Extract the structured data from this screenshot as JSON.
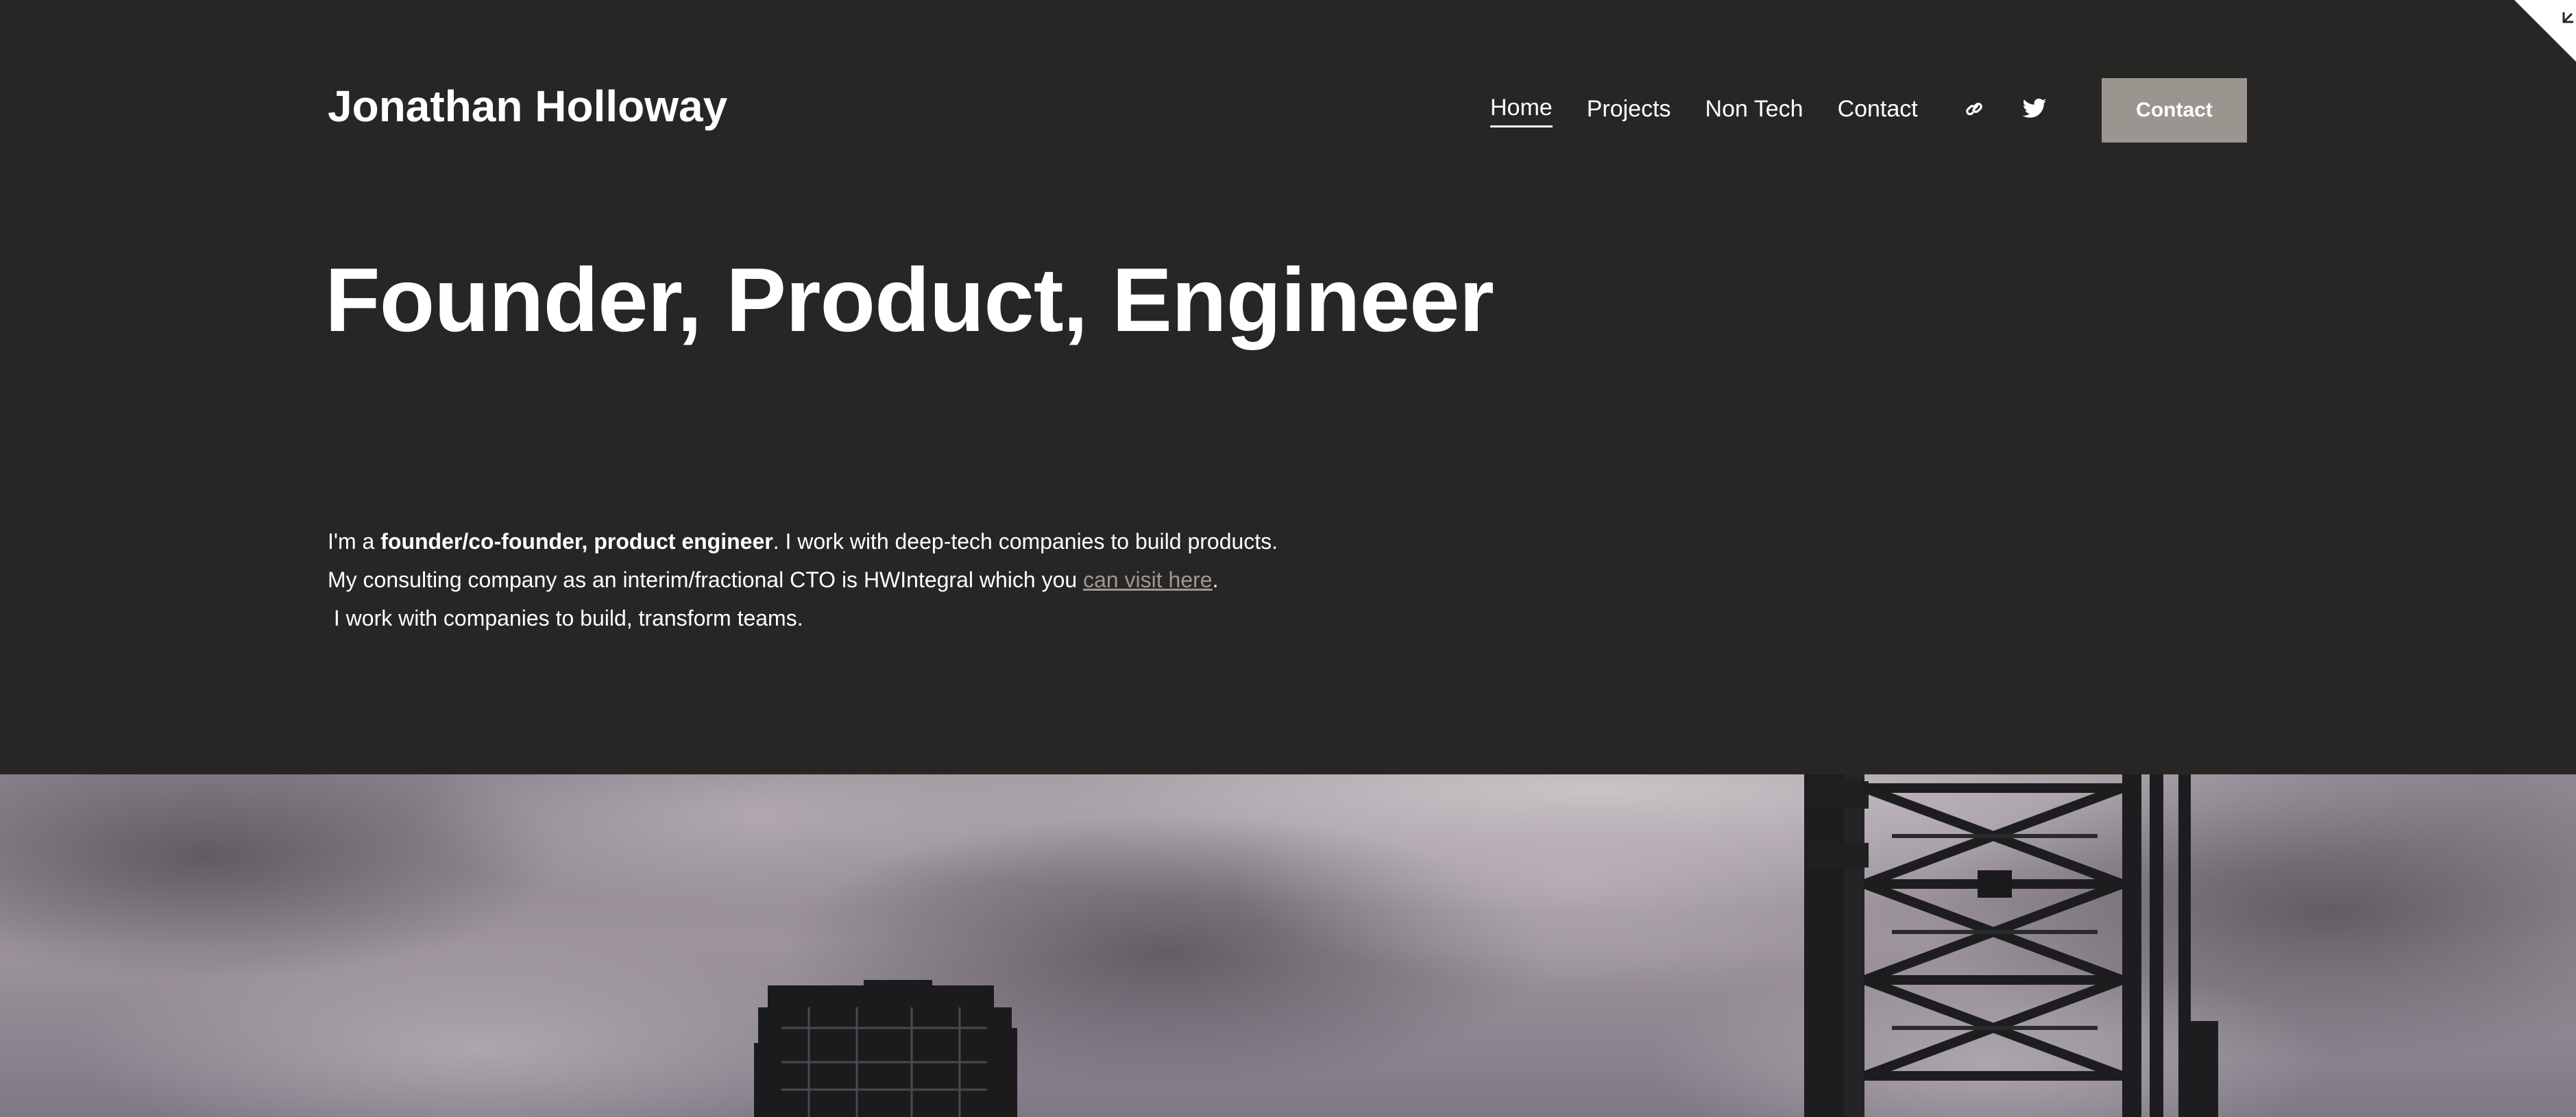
{
  "header": {
    "site_title": "Jonathan Holloway",
    "nav": [
      {
        "label": "Home",
        "active": true
      },
      {
        "label": "Projects",
        "active": false
      },
      {
        "label": "Non Tech",
        "active": false
      },
      {
        "label": "Contact",
        "active": false
      }
    ],
    "social": [
      "link-icon",
      "twitter-icon"
    ],
    "cta_label": "Contact"
  },
  "hero": {
    "headline": "Founder, Product, Engineer",
    "intro": {
      "line1_prefix": "I'm a ",
      "line1_bold": "founder/co-founder, product engineer",
      "line1_suffix": ". I work with deep-tech companies to build products.",
      "line2_prefix": "My consulting company as an interim/fractional CTO is HWIntegral which you ",
      "line2_link": "can visit here",
      "line2_suffix": ".",
      "line3": " I work with companies to build, transform teams."
    }
  },
  "colors": {
    "background": "#272625",
    "text": "#ffffff",
    "button": "#99958f",
    "link": "#9c9893"
  }
}
